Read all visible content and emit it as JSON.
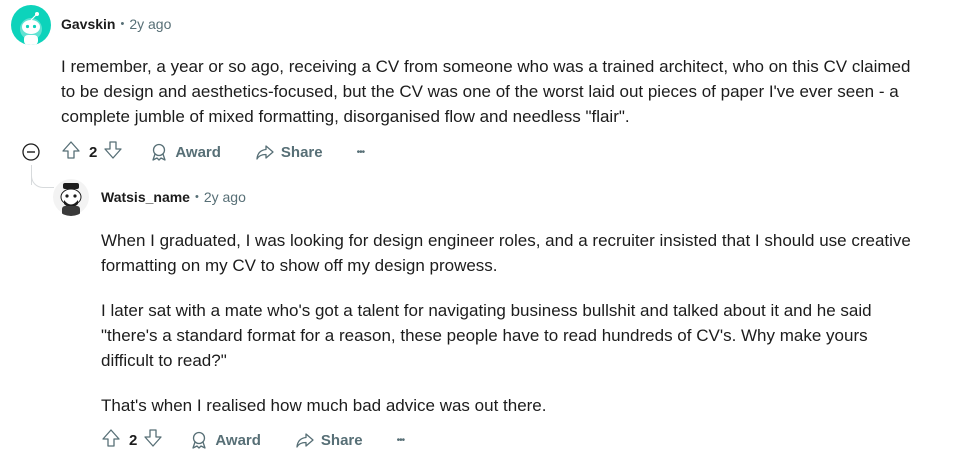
{
  "comment1": {
    "author": "Gavskin",
    "separator": "•",
    "age": "2y ago",
    "body": "I remember, a year or so ago, receiving a CV from someone who was a trained architect, who on this CV claimed to be design and aesthetics-focused, but the CV was one of the worst laid out pieces of paper I've ever seen - a complete jumble of mixed formatting, disorganised flow and needless \"flair\".",
    "votes": "2",
    "award_label": "Award",
    "share_label": "Share",
    "more_label": "•••",
    "collapse_icon": "minus-circle-icon",
    "avatar_color": "#0dd3bb"
  },
  "comment2": {
    "author": "Watsis_name",
    "separator": "•",
    "age": "2y ago",
    "paragraphs": [
      "When I graduated, I was looking for design engineer roles, and a recruiter insisted that I should use creative formatting on my CV to show off my design prowess.",
      "I later sat with a mate who's got a talent for navigating business bullshit and talked about it and he said \"there's a standard format for a reason, these people have to read hundreds of CV's. Why make yours difficult to read?\"",
      "That's when I realised how much bad advice was out there."
    ],
    "votes": "2",
    "award_label": "Award",
    "share_label": "Share",
    "more_label": "•••"
  },
  "colors": {
    "meta": "#576f76",
    "thread_line": "#d7dadc",
    "text": "#1c1c1c"
  }
}
